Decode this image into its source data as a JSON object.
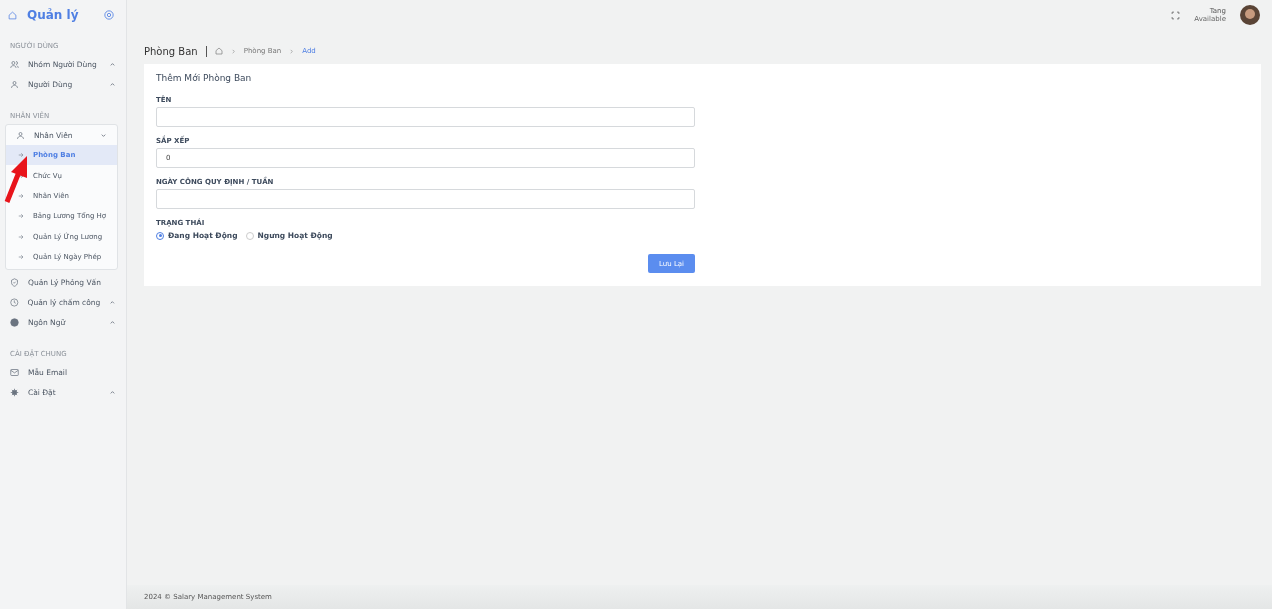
{
  "brand": {
    "title": "Quản lý"
  },
  "sidebar": {
    "sections": [
      {
        "heading": "NGƯỜI DÙNG",
        "items": [
          {
            "label": "Nhóm Người Dùng",
            "caret": true,
            "expanded": false
          },
          {
            "label": "Người Dùng",
            "caret": true,
            "expanded": false
          }
        ]
      },
      {
        "heading": "NHÂN VIÊN",
        "items": [
          {
            "label": "Nhân Viên",
            "caret": true,
            "expanded": true,
            "children": [
              {
                "label": "Phòng Ban",
                "selected": true
              },
              {
                "label": "Chức Vụ",
                "selected": false
              },
              {
                "label": "Nhân Viên",
                "selected": false
              },
              {
                "label": "Bảng Lương Tổng Hợ",
                "selected": false
              },
              {
                "label": "Quản Lý Ứng Lương",
                "selected": false
              },
              {
                "label": "Quản Lý Ngày Phép",
                "selected": false
              }
            ]
          },
          {
            "label": "Quản Lý Phỏng Vấn",
            "caret": false
          },
          {
            "label": "Quản lý chấm công",
            "caret": true,
            "expanded": false
          },
          {
            "label": "Ngôn Ngữ",
            "caret": true,
            "expanded": false
          }
        ]
      },
      {
        "heading": "CÀI ĐẶT CHUNG",
        "items": [
          {
            "label": "Mẫu Email",
            "caret": false
          },
          {
            "label": "Cài Đặt",
            "caret": true,
            "expanded": false
          }
        ]
      }
    ]
  },
  "user": {
    "name": "Tang",
    "status": "Available"
  },
  "breadcrumb": {
    "title": "Phòng Ban",
    "items": [
      "Phòng Ban",
      "Add"
    ]
  },
  "form": {
    "title": "Thêm Mới Phòng Ban",
    "fields": [
      {
        "label": "TÊN"
      },
      {
        "label": "SẮP XẾP",
        "value": "0"
      },
      {
        "label": "NGÀY CÔNG QUY ĐỊNH / TUẦN"
      }
    ],
    "status": {
      "label": "TRẠNG THÁI",
      "options": [
        {
          "label": "Đang Hoạt Động",
          "selected": true
        },
        {
          "label": "Ngưng Hoạt Động",
          "selected": false
        }
      ]
    },
    "submit": "Lưu Lại"
  },
  "footer": "2024 © Salary Management System"
}
